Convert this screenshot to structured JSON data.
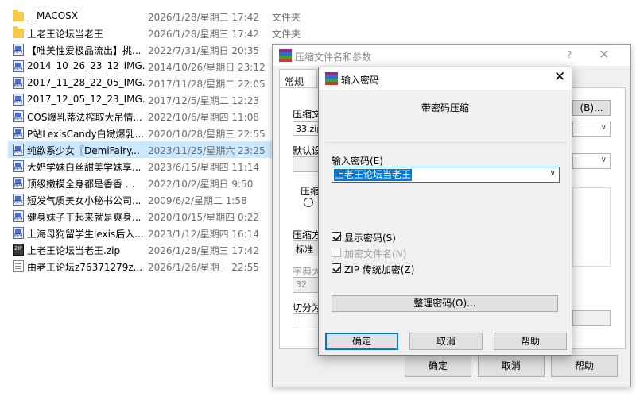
{
  "files": [
    {
      "name": "__MACOSX",
      "date": "2026/1/28/星期三 17:42",
      "type": "文件夹",
      "icon": "folder-icon"
    },
    {
      "name": "上老王论坛当老王",
      "date": "2026/1/28/星期三 17:42",
      "type": "文件夹",
      "icon": "folder-icon"
    },
    {
      "name": "【唯美性爱极品流出】挑...",
      "date": "2022/7/31/星期日 20:35",
      "type": "",
      "icon": "video-icon"
    },
    {
      "name": "2014_10_26_23_12_IMG...",
      "date": "2014/10/26/星期日 23:12",
      "type": "",
      "icon": "video-icon"
    },
    {
      "name": "2017_11_28_22_05_IMG...",
      "date": "2017/11/28/星期二 22:05",
      "type": "",
      "icon": "video-icon"
    },
    {
      "name": "2017_12_05_12_23_IMG...",
      "date": "2017/12/5/星期二 12:23",
      "type": "",
      "icon": "video-icon"
    },
    {
      "name": "COS爆乳蒂法榨取大吊情...",
      "date": "2022/10/6/星期四 11:08",
      "type": "",
      "icon": "video-icon"
    },
    {
      "name": "P站LexisCandy白嫩爆乳...",
      "date": "2020/10/28/星期三 22:55",
      "type": "",
      "icon": "video-icon"
    },
    {
      "name": "纯欲系少女〖DemiFairy...",
      "date": "2023/11/25/星期六 23:25",
      "type": "",
      "icon": "video-icon"
    },
    {
      "name": "大奶学妹白丝甜美学妹享...",
      "date": "2023/6/15/星期四 11:14",
      "type": "",
      "icon": "video-icon"
    },
    {
      "name": "顶级嫩模全身都是香香 ...",
      "date": "2022/10/2/星期日 9:50",
      "type": "",
      "icon": "video-icon"
    },
    {
      "name": "短发气质美女小秘书公司...",
      "date": "2009/6/2/星期二 1:58",
      "type": "",
      "icon": "video-icon"
    },
    {
      "name": "健身妹子干起来就是爽身...",
      "date": "2020/10/15/星期四 0:22",
      "type": "",
      "icon": "video-icon"
    },
    {
      "name": "上海母狗留学生lexis后入...",
      "date": "2023/1/12/星期四 16:14",
      "type": "",
      "icon": "video-icon"
    },
    {
      "name": "上老王论坛当老王.zip",
      "date": "2026/1/28/星期三 17:42",
      "type": "",
      "icon": "zip-icon"
    },
    {
      "name": "由老王论坛z76371279z...",
      "date": "2026/1/26/星期一 22:55",
      "type": "",
      "icon": "doc-icon"
    }
  ],
  "back_dialog": {
    "title": "压缩文件名和参数",
    "help": "?",
    "close": "✕",
    "tab": "常规",
    "archive_label": "压缩文",
    "archive_value": "33.zip",
    "browse_label": "(B)...",
    "default_label": "默认设",
    "format_label": "压缩",
    "method_label": "压缩方",
    "method_value": "标准",
    "dict_label": "字典大",
    "dict_value": "32",
    "split_label": "切分为",
    "ok": "确定",
    "cancel": "取消",
    "help_btn": "帮助"
  },
  "password_dialog": {
    "title": "输入密码",
    "close": "✕",
    "heading": "带密码压缩",
    "password_label": "输入密码(E)",
    "password_value": "上老王论坛当老王",
    "show_password": {
      "label": "显示密码(S)",
      "checked": true,
      "enabled": true
    },
    "encrypt_names": {
      "label": "加密文件名(N)",
      "checked": false,
      "enabled": false
    },
    "zip_legacy": {
      "label": "ZIP 传统加密(Z)",
      "checked": true,
      "enabled": true
    },
    "manage_btn": "整理密码(O)...",
    "ok": "确定",
    "cancel": "取消",
    "help": "帮助"
  }
}
